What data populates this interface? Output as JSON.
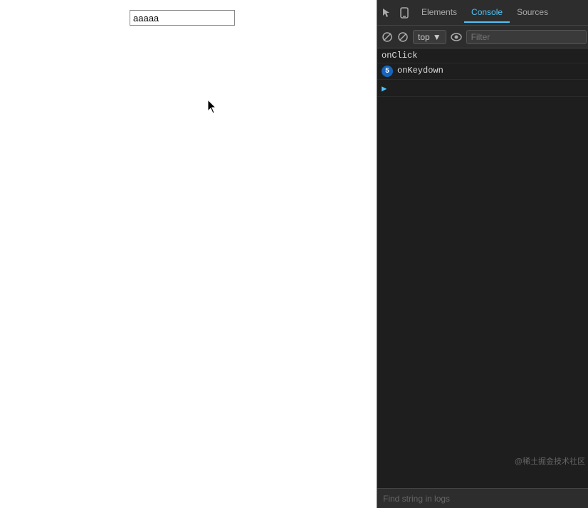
{
  "browser": {
    "input_value": "aaaaa"
  },
  "devtools": {
    "tabs": [
      {
        "label": "Elements",
        "active": false
      },
      {
        "label": "Console",
        "active": true
      },
      {
        "label": "Sources",
        "active": false
      }
    ],
    "toolbar2": {
      "top_label": "top",
      "filter_placeholder": "Filter"
    },
    "console": {
      "entries": [
        {
          "type": "onclick",
          "text": "onClick",
          "has_badge": false
        },
        {
          "type": "onkeydown",
          "text": "onKeydown",
          "has_badge": true,
          "badge_count": "5"
        }
      ],
      "arrow_collapsed": "▶"
    },
    "watermark": "@稀土掘金技术社区",
    "find_placeholder": "Find string in logs"
  }
}
